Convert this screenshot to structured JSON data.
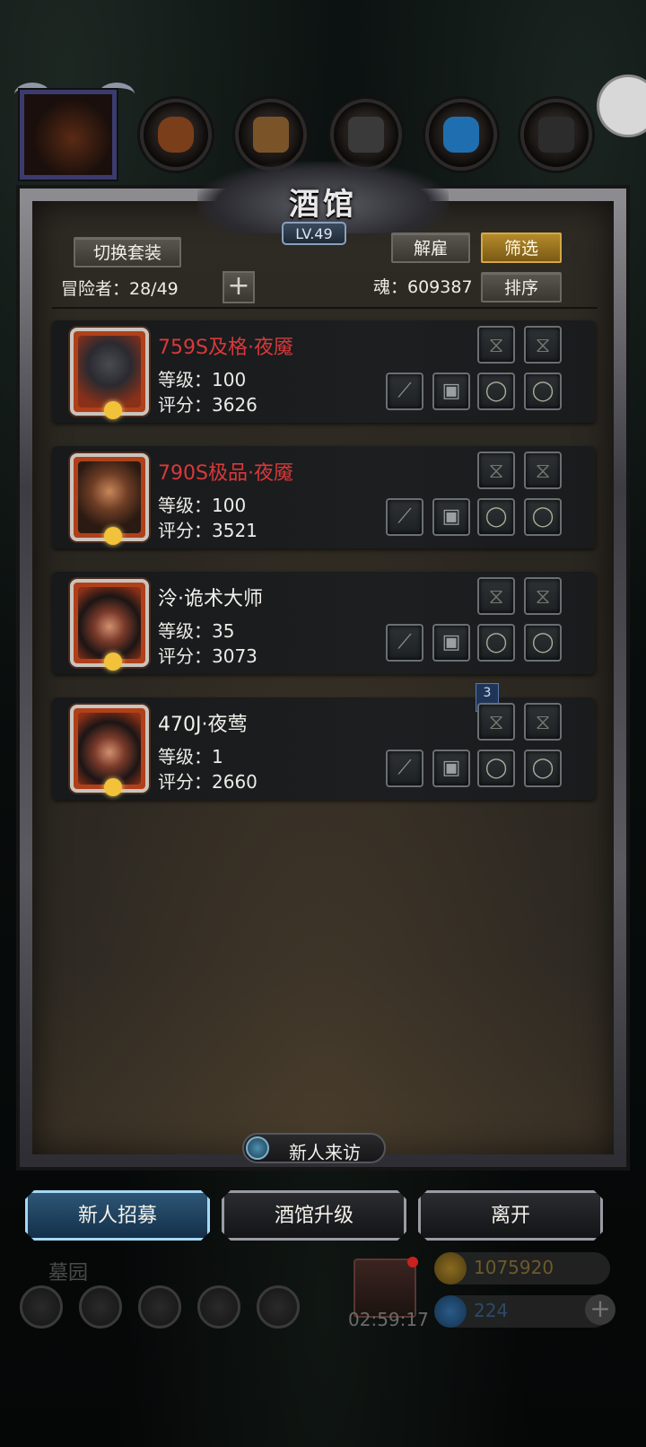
{
  "panel": {
    "title": "酒馆",
    "level": "LV.49",
    "switch_outfit_label": "切换套装",
    "dismiss_label": "解雇",
    "filter_label": "筛选",
    "sort_label": "排序",
    "adventurers_text": "冒险者：28/49",
    "soul_text": "魂：609387",
    "add_label": "+"
  },
  "adventurers": [
    {
      "name": "759S及格·夜魇",
      "name_color": "#d9393a",
      "level_text": "等级：100",
      "score_text": "评分：3626"
    },
    {
      "name": "790S极品·夜魇",
      "name_color": "#d9393a",
      "level_text": "等级：100",
      "score_text": "评分：3521"
    },
    {
      "name": "泠·诡术大师",
      "name_color": "#f2f0ea",
      "level_text": "等级：35",
      "score_text": "评分：3073"
    },
    {
      "name": "470J·夜莺",
      "name_color": "#f2f0ea",
      "level_text": "等级：1",
      "score_text": "评分：2660"
    }
  ],
  "bookmark_count": "3",
  "visitor_label": "新人来访",
  "buttons": {
    "recruit": "新人招募",
    "upgrade": "酒馆升级",
    "leave": "离开"
  },
  "bottom": {
    "location": "墓园",
    "timer": "02:59:17",
    "gold": "1075920",
    "gems": "224"
  },
  "icons": {
    "hourglass": "hourglass-icon",
    "blade": "blade-icon",
    "armor": "armor-icon",
    "ring": "ring-icon"
  },
  "colors": {
    "accent_gold": "#d4a845",
    "active_blue": "#a6d8f5",
    "name_red": "#d9393a"
  }
}
